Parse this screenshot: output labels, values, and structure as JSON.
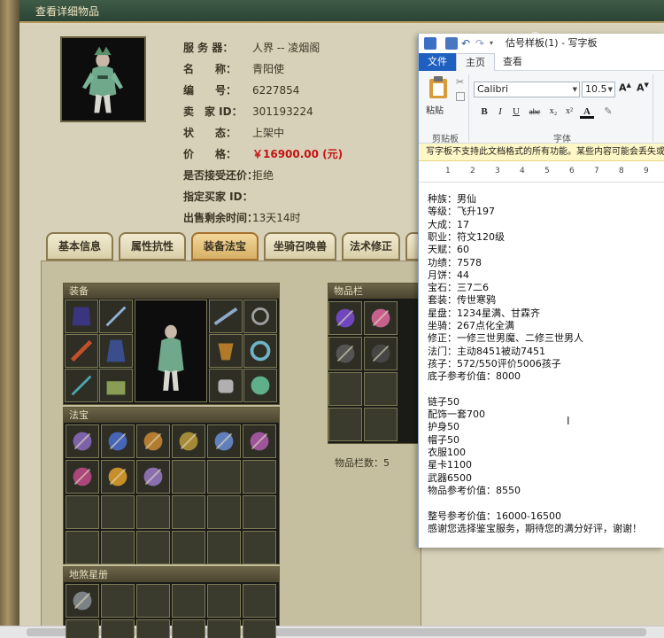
{
  "game": {
    "title": "查看详细物品",
    "info": [
      {
        "label": "服 务 器：",
        "value": "人界 -- 凌烟阁"
      },
      {
        "label": "名　　称：",
        "value": "青阳使"
      },
      {
        "label": "编　　号：",
        "value": "6227854"
      },
      {
        "label": "卖　家 ID：",
        "value": "301193224"
      },
      {
        "label": "状　　态：",
        "value": "上架中"
      },
      {
        "label": "价　　格：",
        "value": "￥16900.00 (元)"
      },
      {
        "label": "是否接受还价：",
        "value": "拒绝"
      },
      {
        "label": "指定买家 ID：",
        "value": ""
      },
      {
        "label": "出售剩余时间：",
        "value": "13天14时"
      }
    ],
    "tabs": [
      "基本信息",
      "属性抗性",
      "装备法宝",
      "坐骑召唤兽",
      "法术修正"
    ],
    "active_tab": "装备法宝",
    "sections": {
      "equipment": "装备",
      "fabao": "法宝",
      "inventory": "物品栏",
      "beast_book": "地煞星册"
    },
    "slot_count": "物品栏数：5"
  },
  "wordpad": {
    "title": "估号样板(1) - 写字板",
    "tabs": {
      "file": "文件",
      "home": "主页",
      "view": "查看"
    },
    "paste_label": "粘贴",
    "clipboard_label": "剪贴板",
    "font_group_label": "字体",
    "font_name": "Calibri",
    "font_size": "10.5",
    "format_buttons": [
      "B",
      "I",
      "U",
      "abc",
      "x₂",
      "x²"
    ],
    "info_bar": "写字板不支持此文档格式的所有功能。某些内容可能会丢失或显示",
    "ruler_numbers": [
      "1",
      "2",
      "3",
      "4",
      "5",
      "6",
      "7",
      "8",
      "9"
    ],
    "doc_lines": [
      "种族：男仙",
      "等级：飞升197",
      "大成：17",
      "职业：符文120级",
      "天赋：60",
      "功绩：7578",
      "月饼：44",
      "宝石：三7二6",
      "套装：传世寒鸦",
      "星盘：1234星满、甘霖齐",
      "坐骑：267点化全满",
      "修正：一修三世男魔、二修三世男人",
      "法门：主动8451被动7451",
      "孩子：572/550评价5006孩子",
      "底子参考价值：8000",
      "",
      "链子50",
      "配饰一套700",
      "护身50",
      "帽子50",
      "衣服100",
      "星卡1100",
      "武器6500",
      "物品参考价值：8550",
      "",
      "整号参考价值：16000-16500",
      "感谢您选择鉴宝服务，期待您的满分好评，谢谢！"
    ]
  },
  "colors": {
    "price": "#c41313",
    "file_tab": "#1f5fbf",
    "title_bar": "#2b4433"
  }
}
